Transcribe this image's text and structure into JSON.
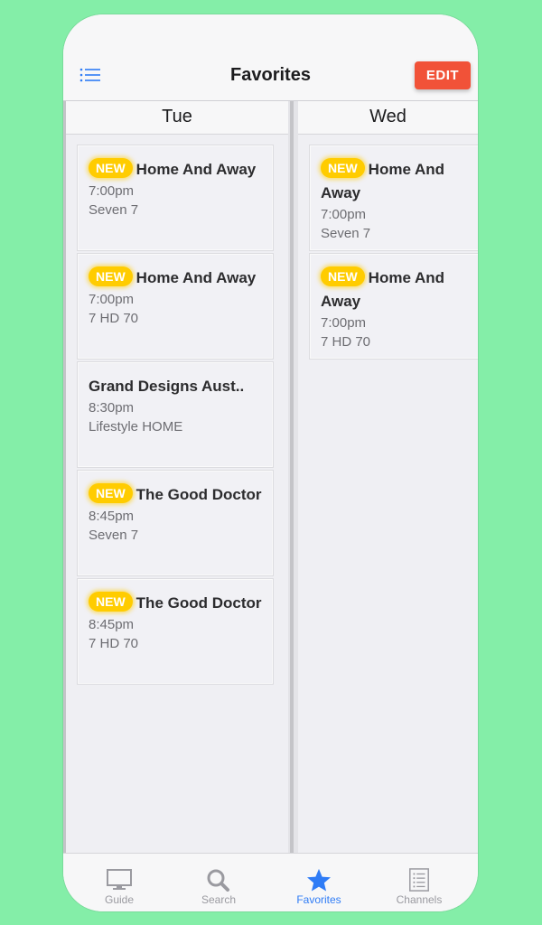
{
  "header": {
    "title": "Favorites",
    "edit_label": "EDIT",
    "menu_icon": "list-icon"
  },
  "badge_label": "NEW",
  "columns": [
    {
      "day": "Tue",
      "items": [
        {
          "new": true,
          "title": "Home And Away",
          "time": "7:00pm",
          "channel": "Seven 7"
        },
        {
          "new": true,
          "title": "Home And Away",
          "time": "7:00pm",
          "channel": "7 HD 70"
        },
        {
          "new": false,
          "title": "Grand Designs Aust..",
          "time": "8:30pm",
          "channel": "Lifestyle HOME"
        },
        {
          "new": true,
          "title": "The Good Doctor",
          "time": "8:45pm",
          "channel": "Seven 7"
        },
        {
          "new": true,
          "title": "The Good Doctor",
          "time": "8:45pm",
          "channel": "7 HD 70"
        }
      ]
    },
    {
      "day": "Wed",
      "items": [
        {
          "new": true,
          "title": "Home And Away",
          "time": "7:00pm",
          "channel": "Seven 7"
        },
        {
          "new": true,
          "title": "Home And Away",
          "time": "7:00pm",
          "channel": "7 HD 70"
        }
      ]
    }
  ],
  "tabs": [
    {
      "label": "Guide",
      "icon": "tv-monitor-icon",
      "active": false
    },
    {
      "label": "Search",
      "icon": "magnifier-icon",
      "active": false
    },
    {
      "label": "Favorites",
      "icon": "star-icon",
      "active": true
    },
    {
      "label": "Channels",
      "icon": "channel-list-icon",
      "active": false
    }
  ],
  "colors": {
    "background": "#84eea8",
    "edit_button": "#f15238",
    "badge": "#ffcc00",
    "active_tab": "#2f7cf6",
    "inactive_tab": "#9a9aa0"
  }
}
